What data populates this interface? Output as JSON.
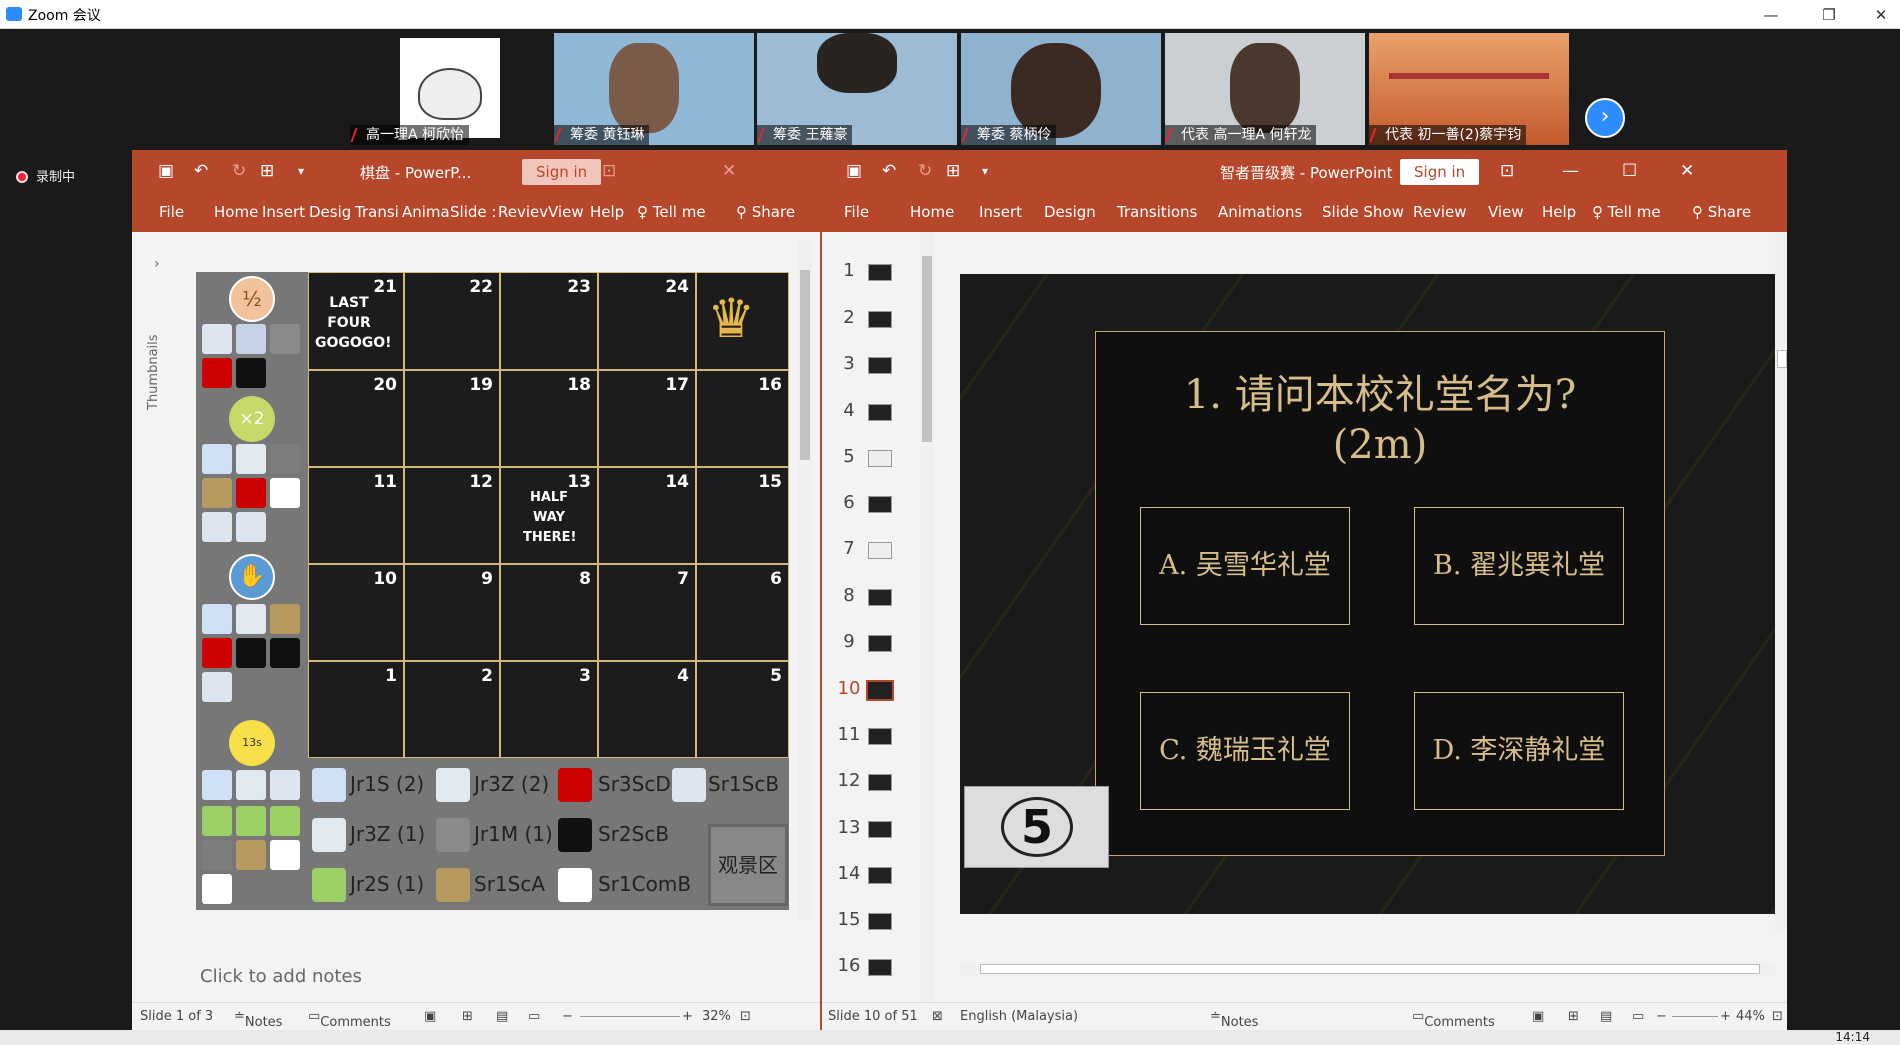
{
  "window": {
    "title": "Zoom 会议",
    "min": "—",
    "max": "❐",
    "close": "✕"
  },
  "participants": [
    {
      "name": "高一理A 柯欣怡",
      "color": "#ffffff"
    },
    {
      "name": "筹委 黄钰琳",
      "color": "#8fb7d6"
    },
    {
      "name": "筹委 王薙豪",
      "color": "#9cbbd4"
    },
    {
      "name": "筹委 蔡柄伶",
      "color": "#8fb2cf"
    },
    {
      "name": "代表 高一理A 何轩龙",
      "color": "#c9cfd3"
    },
    {
      "name": "代表 初一善(2)蔡宇钧",
      "color": "#d98a57"
    }
  ],
  "recording_label": "录制中",
  "ppt_left": {
    "doc_title": "棋盘  -  PowerP...",
    "sign_in": "Sign in",
    "tabs": [
      "File",
      "Home",
      "Insert",
      "Desig",
      "Transi",
      "Anima",
      "Slide :",
      "Reviev",
      "View",
      "Help",
      "Tell me",
      "Share"
    ],
    "thumbnails_label": "Thumbnails",
    "notes_placeholder": "Click to add notes",
    "status": {
      "slide": "Slide 1 of 3",
      "notes": "Notes",
      "comments": "Comments",
      "zoom": "32%"
    },
    "board": {
      "row1": [
        "21",
        "22",
        "23",
        "24"
      ],
      "row1_text": "LAST FOUR GOGOGO!",
      "row2": [
        "20",
        "19",
        "18",
        "17",
        "16"
      ],
      "row3": [
        "11",
        "12",
        "13",
        "14",
        "15"
      ],
      "row3_text": "HALF WAY THERE!",
      "row4": [
        "10",
        "9",
        "8",
        "7",
        "6"
      ],
      "row5": [
        "1",
        "2",
        "3",
        "4",
        "5"
      ],
      "badges": [
        "½",
        "×2",
        "✋",
        "13s"
      ],
      "teams": [
        "Jr1S (2)",
        "Jr3Z (2)",
        "Sr3ScD",
        "Sr1ScB",
        "Jr3Z (1)",
        "Jr1M (1)",
        "Sr2ScB",
        "Jr2S (1)",
        "Sr1ScA",
        "Sr1ComB"
      ],
      "viewing_area": "观景区"
    }
  },
  "ppt_right": {
    "doc_title": "智者晋级赛  -  PowerPoint",
    "sign_in": "Sign in",
    "tabs": [
      "File",
      "Home",
      "Insert",
      "Design",
      "Transitions",
      "Animations",
      "Slide Show",
      "Review",
      "View",
      "Help",
      "Tell me",
      "Share"
    ],
    "slide_numbers": [
      "1",
      "2",
      "3",
      "4",
      "5",
      "6",
      "7",
      "8",
      "9",
      "10",
      "11",
      "12",
      "13",
      "14",
      "15",
      "16"
    ],
    "active_slide": "10",
    "question": "1. 请问本校礼堂名为?",
    "question_sub": "(2m)",
    "answers": [
      "A. 吴雪华礼堂",
      "B. 翟兆巽礼堂",
      "C. 魏瑞玉礼堂",
      "D. 李深静礼堂"
    ],
    "timer": "5",
    "status": {
      "slide": "Slide 10 of 51",
      "language": "English (Malaysia)",
      "notes": "Notes",
      "comments": "Comments",
      "zoom": "44%"
    }
  },
  "taskbar": {
    "clock": "14:14"
  }
}
